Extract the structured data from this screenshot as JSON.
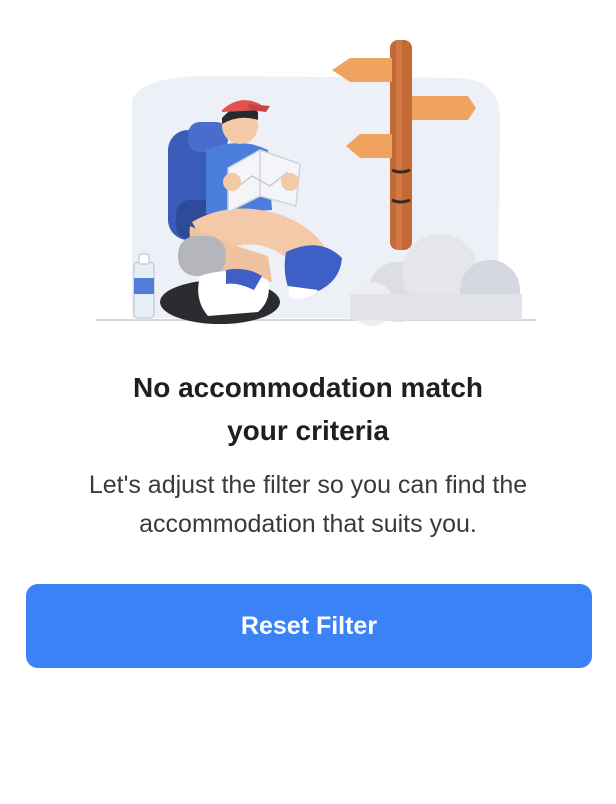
{
  "empty_state": {
    "illustration": "traveler-with-map-and-signpost-illustration",
    "title_line_1": "No accommodation match",
    "title_line_2": "your criteria",
    "message": "Let's adjust the filter so you can find the accommodation that suits you.",
    "reset_button_label": "Reset Filter"
  },
  "colors": {
    "accent": "#3b82f6",
    "background": "#ffffff",
    "title": "#1f1f1f",
    "message": "#3a3a3a"
  }
}
